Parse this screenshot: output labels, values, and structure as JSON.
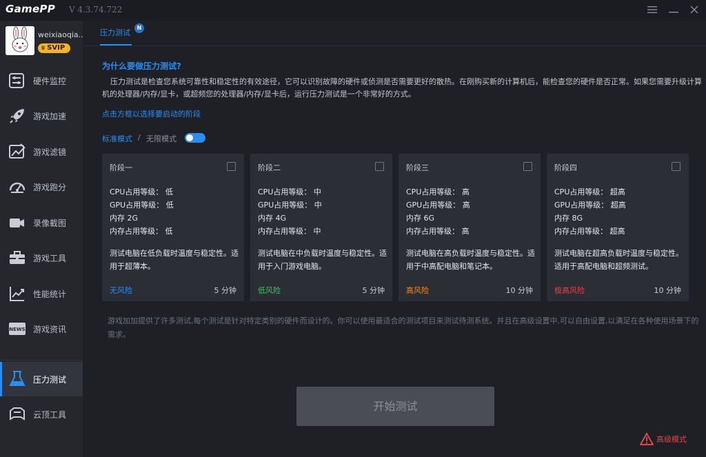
{
  "app": {
    "logo": "GamePP",
    "version": "V 4.3.74.722"
  },
  "user": {
    "name": "weixiaoqia...",
    "badge": "SVIP"
  },
  "sidebar": {
    "items": [
      {
        "label": "硬件监控",
        "icon": "hardware-monitor-icon"
      },
      {
        "label": "游戏加速",
        "icon": "rocket-icon"
      },
      {
        "label": "游戏滤镜",
        "icon": "filter-icon"
      },
      {
        "label": "游戏跑分",
        "icon": "speedometer-icon"
      },
      {
        "label": "录像截图",
        "icon": "video-camera-icon"
      },
      {
        "label": "游戏工具",
        "icon": "toolbox-icon"
      },
      {
        "label": "性能统计",
        "icon": "chart-icon"
      },
      {
        "label": "游戏资讯",
        "icon": "news-icon"
      },
      {
        "label": "压力测试",
        "icon": "flask-icon"
      },
      {
        "label": "云顶工具",
        "icon": "cloud-tool-icon"
      }
    ],
    "active_index": 8
  },
  "tab": {
    "label": "压力测试",
    "badge": "N"
  },
  "intro": {
    "title": "为什么要做压力测试?",
    "description": "压力测试是检查您系统可靠性和稳定性的有效途径，它可以识别故障的硬件或侦测是否需要更好的散热。在刚购买新的计算机后，能检查您的硬件是否正常。如果您需要升级计算机的处理器/内存/显卡，或超频您的处理器/内存/显卡后，运行压力测试是一个非常好的方式。",
    "hint": "点击方框以选择要启动的阶段"
  },
  "modes": {
    "standard": "标准模式",
    "separator": "/",
    "infinite": "无限模式",
    "toggle_on": true
  },
  "stages": [
    {
      "name": "阶段一",
      "cpu": "CPU占用等级：  低",
      "gpu": "GPU占用等级：  低",
      "mem": "内存  2G",
      "mem_level": "内存占用等级：  低",
      "desc": "测试电脑在低负载时温度与稳定性。适用于超薄本。",
      "risk": "无风险",
      "risk_color": "#2a8df0",
      "time": "5 分钟"
    },
    {
      "name": "阶段二",
      "cpu": "CPU占用等级：  中",
      "gpu": "GPU占用等级：  中",
      "mem": "内存  4G",
      "mem_level": "内存占用等级：  中",
      "desc": "测试电脑在中负载时温度与稳定性。适用于入门游戏电脑。",
      "risk": "低风险",
      "risk_color": "#3cc36a",
      "time": "5 分钟"
    },
    {
      "name": "阶段三",
      "cpu": "CPU占用等级：  高",
      "gpu": "GPU占用等级：  高",
      "mem": "内存  6G",
      "mem_level": "内存占用等级：  高",
      "desc": "测试电脑在高负载时温度与稳定性。适用于中高配电脑和笔记本。",
      "risk": "高风险",
      "risk_color": "#f08a24",
      "time": "10 分钟"
    },
    {
      "name": "阶段四",
      "cpu": "CPU占用等级：  超高",
      "gpu": "GPU占用等级：  超高",
      "mem": "内存  8G",
      "mem_level": "内存占用等级：  超高",
      "desc": "测试电脑在超高负载时温度与稳定性。适用于高配电脑和超频测试。",
      "risk": "极高风险",
      "risk_color": "#e04646",
      "time": "10 分钟"
    }
  ],
  "note": "游戏加加提供了许多测试,每个测试是针对特定类别的硬件而设计的。你可以使用最适合的测试项目来测试待测系统。并且在高级设置中,可以自由设置,以满足在各种使用场景下的需求。",
  "start_button": "开始测试",
  "advanced_mode": "高级模式",
  "colors": {
    "accent": "#2a8df0",
    "danger": "#e04646",
    "svip": "#f5b521"
  }
}
